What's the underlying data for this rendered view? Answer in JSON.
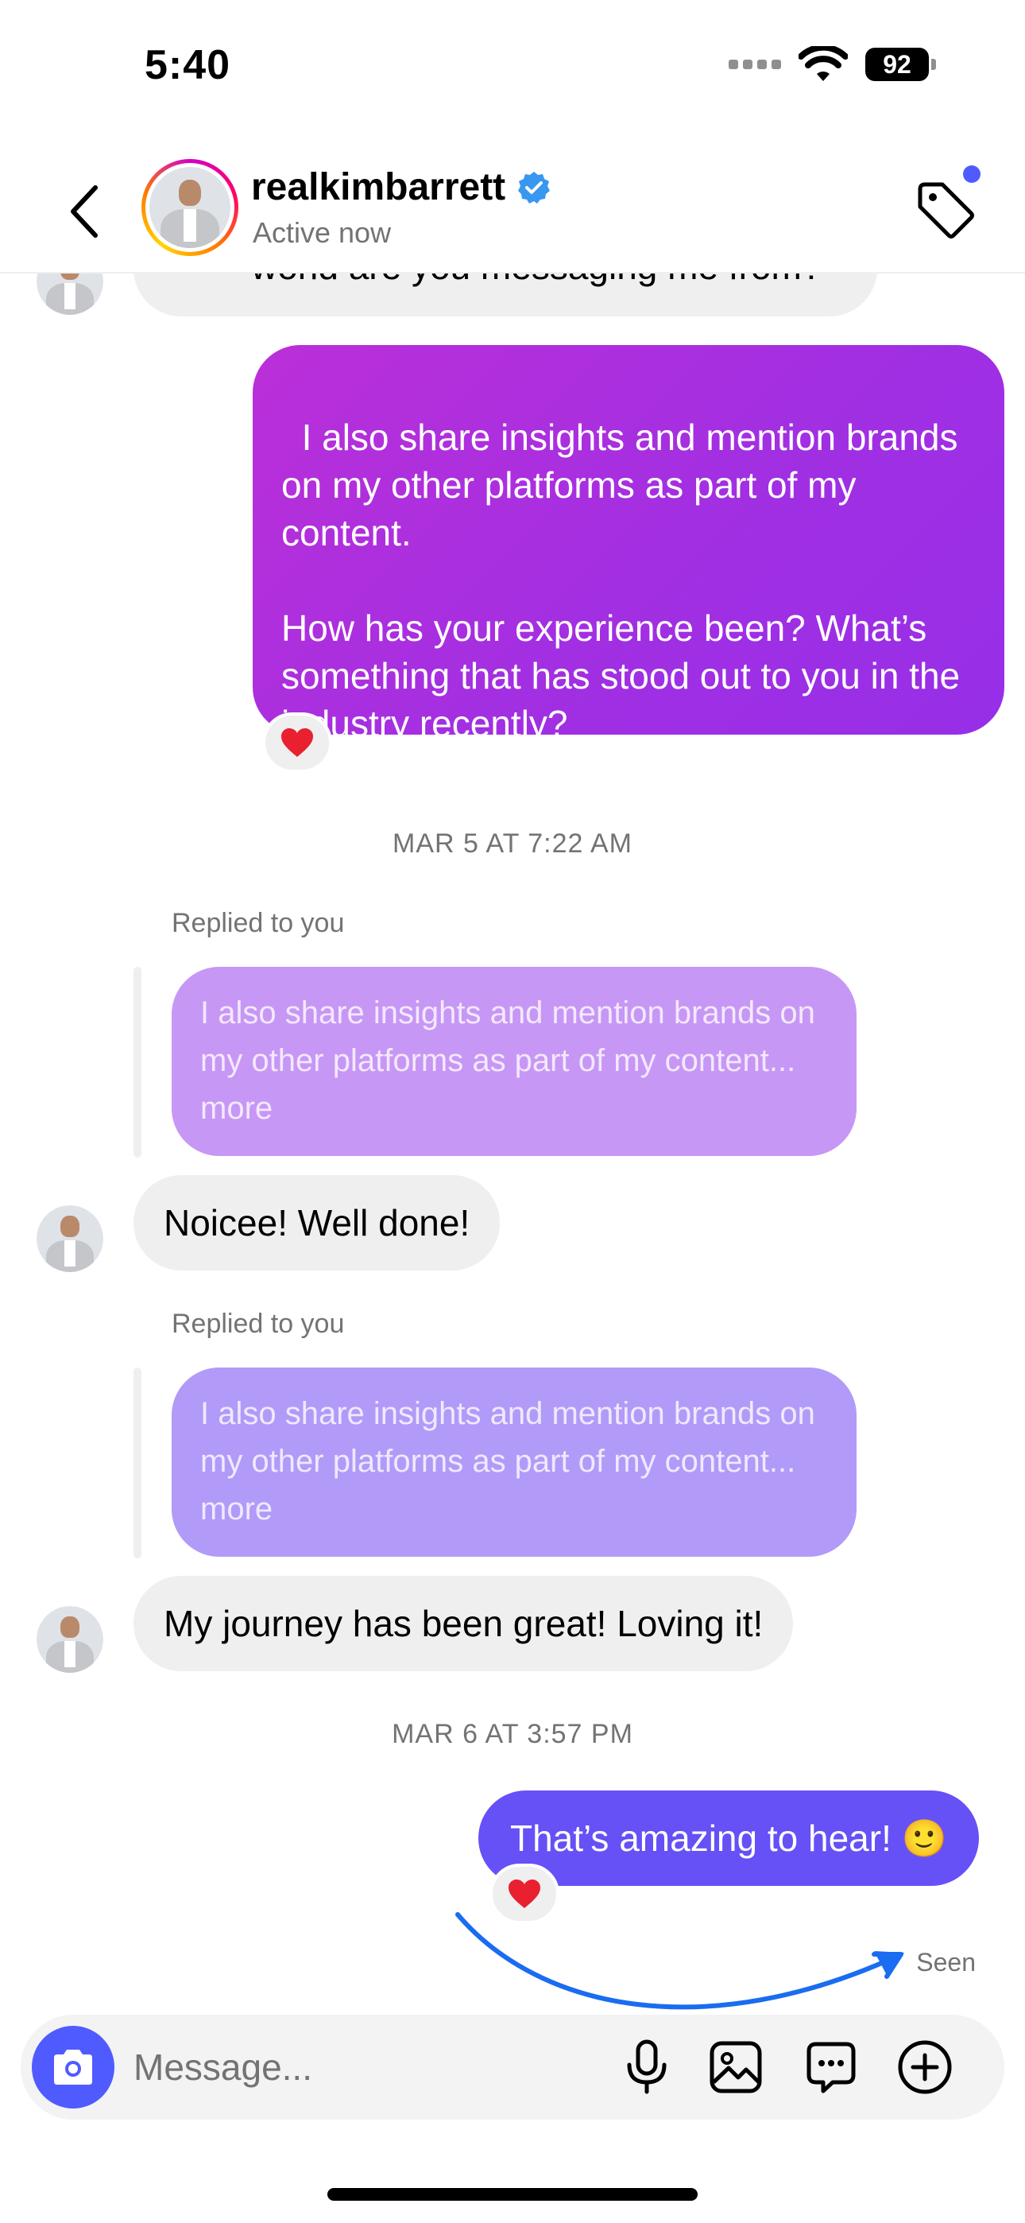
{
  "status_bar": {
    "time": "5:40",
    "battery": "92"
  },
  "header": {
    "username": "realkimbarrett",
    "presence": "Active now"
  },
  "messages": {
    "partial_in_text": "world are you messaging me from?",
    "out_long_text": "I also share insights and mention brands on my other platforms as part of my content.\n\nHow has your experience been? What’s something that has stood out to you in the industry recently?",
    "reaction_heart": "❤️",
    "timestamp_1": "MAR 5 AT 7:22 AM",
    "replied_label": "Replied to you",
    "reply_quote": "I also share insights and mention brands on my other platforms as part of my content... more",
    "in_1": "Noicee! Well done!",
    "in_2": "My journey has been great! Loving it!",
    "timestamp_2": "MAR 6 AT 3:57 PM",
    "out_short_text": "That’s amazing to hear! 🙂",
    "seen": "Seen"
  },
  "composer": {
    "placeholder": "Message..."
  },
  "colors": {
    "accent_blue": "#4f5bff",
    "gradient_purple_start": "#b92ed8",
    "gradient_purple_end": "#9d2ee6",
    "quote_1": "#c797f5",
    "quote_2": "#b29af8",
    "annotation_arrow": "#1a6cf0"
  },
  "icons": [
    "back-icon",
    "verified-badge-icon",
    "tag-icon",
    "camera-icon",
    "microphone-icon",
    "gallery-icon",
    "sticker-icon",
    "plus-icon",
    "heart-icon"
  ]
}
